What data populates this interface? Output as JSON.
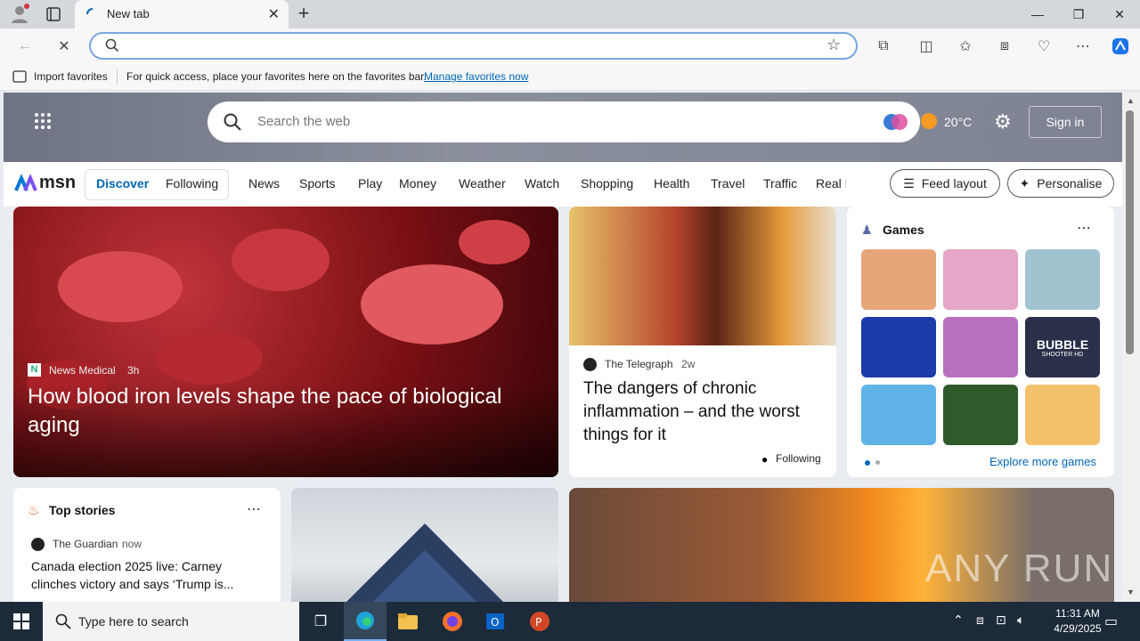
{
  "browser": {
    "tab_title": "New tab",
    "new_tab": "+",
    "favorites_bar": {
      "import": "Import favorites",
      "message": "For quick access, place your favorites here on the favorites bar.",
      "manage_link": "Manage favorites now"
    }
  },
  "msn": {
    "search_placeholder": "Search the web",
    "weather": "20°C",
    "sign_in": "Sign in",
    "logo": "msn",
    "tabs": [
      "Discover",
      "Following"
    ],
    "nav": [
      "News",
      "Sports",
      "Play",
      "Money",
      "Weather",
      "Watch",
      "Shopping",
      "Health",
      "Travel",
      "Traffic",
      "Real E"
    ],
    "feed_layout": "Feed layout",
    "personalise": "Personalise"
  },
  "hero": {
    "source": "News Medical",
    "age": "3h",
    "headline": "How blood iron levels shape the pace of biological aging"
  },
  "story2": {
    "source": "The Telegraph",
    "age": "2w",
    "headline": "The dangers of chronic inflammation – and the worst things for it",
    "following": "Following"
  },
  "games": {
    "title": "Games",
    "explore": "Explore more games",
    "bubble_line1": "BUBBLE",
    "bubble_line2": "SHOOTER HD"
  },
  "top_stories": {
    "title": "Top stories",
    "source": "The Guardian",
    "age": "now",
    "headline": "Canada election 2025 live: Carney clinches victory and says ‘Trump is..."
  },
  "watermark": "ANY RUN",
  "taskbar": {
    "search_placeholder": "Type here to search",
    "time": "11:31 AM",
    "date": "4/29/2025"
  },
  "colors": {
    "accent": "#0067b8",
    "taskbar": "#1c2a3a"
  }
}
